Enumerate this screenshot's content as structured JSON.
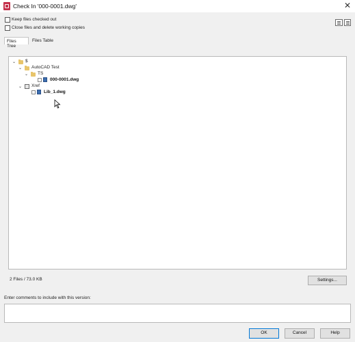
{
  "window": {
    "title": "Check In '000-0001.dwg'",
    "close_glyph": "✕"
  },
  "options": {
    "keep_checked_out": {
      "label": "Keep files checked out",
      "checked": false
    },
    "close_delete": {
      "label": "Close files and delete working copies",
      "checked": false
    }
  },
  "tabs": [
    {
      "label": "Files Tree",
      "active": true
    },
    {
      "label": "Files Table",
      "active": false
    }
  ],
  "tree": {
    "root": {
      "label": "$"
    },
    "project": {
      "label": "AutoCAD Test"
    },
    "folder_ts": {
      "label": "TS"
    },
    "file_main": {
      "label": "000-0001.dwg"
    },
    "xref_group": {
      "label": "Xref"
    },
    "file_lib": {
      "label": "Lib_1.dwg"
    }
  },
  "footer": {
    "summary": "2 Files / 73.0 KB",
    "settings_label": "Settings..."
  },
  "comments": {
    "label": "Enter comments to include with this version:",
    "value": ""
  },
  "buttons": {
    "ok": "OK",
    "cancel": "Cancel",
    "help": "Help"
  },
  "icons": [
    "app-icon",
    "close-icon",
    "report-icon",
    "comment-icon",
    "folder-icon",
    "dwg-file-icon",
    "xref-icon",
    "mouse-cursor-icon"
  ]
}
